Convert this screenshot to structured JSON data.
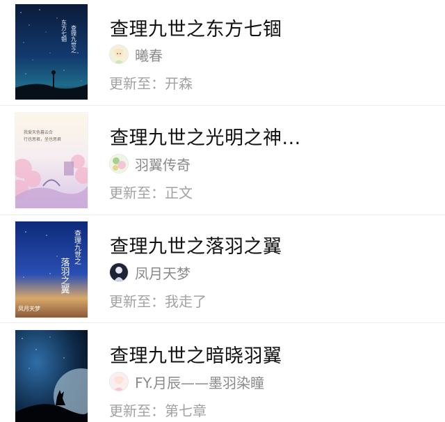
{
  "books": [
    {
      "title": "查理九世之东方七锢",
      "author": "曦春",
      "update_prefix": "更新至：",
      "latest_chapter": "开森",
      "cover_text": [
        "查理九世之",
        "东方七锢"
      ],
      "avatar_icon": "anime-girl-avatar"
    },
    {
      "title": "查理九世之光明之神...",
      "author": "羽翼传奇",
      "update_prefix": "更新至：",
      "latest_chapter": "正文",
      "cover_text": [
        "我爱天色暮云合",
        "行也思君，坐也思君"
      ],
      "avatar_icon": "floral-avatar"
    },
    {
      "title": "查理九世之落羽之翼",
      "author": "凤月天梦",
      "update_prefix": "更新至：",
      "latest_chapter": "我走了",
      "cover_text": [
        "查理九世之",
        "落羽之翼",
        "凤月天梦"
      ],
      "avatar_icon": "dark-anime-avatar"
    },
    {
      "title": "查理九世之暗晓羽翼",
      "author": "FY.月辰——墨羽染瞳",
      "update_prefix": "更新至：",
      "latest_chapter": "第七章",
      "cover_text": [],
      "avatar_icon": "pink-anime-avatar"
    }
  ],
  "colors": {
    "title": "#111111",
    "author": "#8a8a8a",
    "update": "#a2a2a2",
    "divider": "#ececec"
  }
}
